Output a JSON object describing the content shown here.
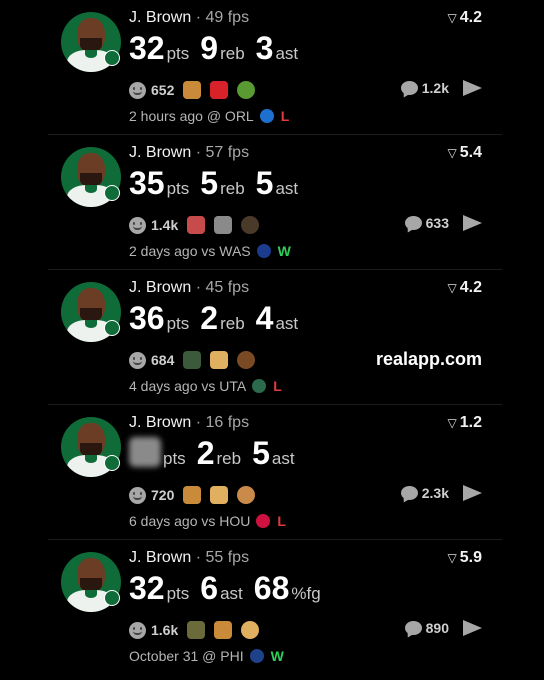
{
  "posts": [
    {
      "player": "J. Brown",
      "fps": "· 49 fps",
      "score": "4.2",
      "stats": [
        {
          "value": "32",
          "unit": "pts"
        },
        {
          "value": "9",
          "unit": "reb"
        },
        {
          "value": "3",
          "unit": "ast"
        }
      ],
      "stat1_blurred": false,
      "reaction_count": "652",
      "emojis": [
        "person-tipping-hand-emoji",
        "turkey-flag-emoji",
        "nauseated-face-emoji"
      ],
      "emoji_colors": [
        "#c98a3a",
        "#d8222a",
        "#5a9a32"
      ],
      "comment_count": "1.2k",
      "show_watermark": false,
      "game_text": "2 hours ago @ ORL",
      "opponent_logo": "orl-logo-icon",
      "opponent_color": "#1f6fcf",
      "result": "L"
    },
    {
      "player": "J. Brown",
      "fps": "· 57 fps",
      "score": "5.4",
      "stats": [
        {
          "value": "35",
          "unit": "pts"
        },
        {
          "value": "5",
          "unit": "reb"
        },
        {
          "value": "5",
          "unit": "ast"
        }
      ],
      "stat1_blurred": false,
      "reaction_count": "1.4k",
      "emojis": [
        "barber-pole-emoji",
        "goat-emoji",
        "guitar-player-emoji"
      ],
      "emoji_colors": [
        "#c84b4b",
        "#8a8a8a",
        "#4a3a2a"
      ],
      "comment_count": "633",
      "show_watermark": false,
      "game_text": "2 days ago vs WAS",
      "opponent_logo": "was-logo-icon",
      "opponent_color": "#1b3c8c",
      "result": "W"
    },
    {
      "player": "J. Brown",
      "fps": "· 45 fps",
      "score": "4.2",
      "stats": [
        {
          "value": "36",
          "unit": "pts"
        },
        {
          "value": "2",
          "unit": "reb"
        },
        {
          "value": "4",
          "unit": "ast"
        }
      ],
      "stat1_blurred": false,
      "reaction_count": "684",
      "emojis": [
        "person-emoji",
        "baby-emoji",
        "pile-of-poo-emoji"
      ],
      "emoji_colors": [
        "#3b5a3b",
        "#e0b060",
        "#7a4a24"
      ],
      "comment_count": "",
      "show_watermark": true,
      "watermark": "realapp.com",
      "game_text": "4 days ago vs UTA",
      "opponent_logo": "uta-logo-icon",
      "opponent_color": "#2b6a4a",
      "result": "L"
    },
    {
      "player": "J. Brown",
      "fps": "· 16 fps",
      "score": "1.2",
      "stats": [
        {
          "value": "",
          "unit": "pts"
        },
        {
          "value": "2",
          "unit": "reb"
        },
        {
          "value": "5",
          "unit": "ast"
        }
      ],
      "stat1_blurred": true,
      "reaction_count": "720",
      "emojis": [
        "person-tipping-hand-emoji",
        "baby-emoji",
        "cookie-emoji"
      ],
      "emoji_colors": [
        "#c98a3a",
        "#e0b060",
        "#c98a4a"
      ],
      "comment_count": "2.3k",
      "show_watermark": false,
      "game_text": "6 days ago vs HOU",
      "opponent_logo": "hou-logo-icon",
      "opponent_color": "#ce1141",
      "result": "L"
    },
    {
      "player": "J. Brown",
      "fps": "· 55 fps",
      "score": "5.9",
      "stats": [
        {
          "value": "32",
          "unit": "pts"
        },
        {
          "value": "6",
          "unit": "ast"
        },
        {
          "value": "68",
          "unit": "%fg"
        }
      ],
      "stat1_blurred": false,
      "reaction_count": "1.6k",
      "emojis": [
        "hand-gesture-emoji",
        "person-tipping-hand-emoji",
        "baby-emoji"
      ],
      "emoji_colors": [
        "#6a6a3a",
        "#c98a3a",
        "#e0b060"
      ],
      "comment_count": "890",
      "show_watermark": false,
      "game_text": "October 31 @ PHI",
      "opponent_logo": "phi-logo-icon",
      "opponent_color": "#1d428a",
      "result": "W"
    }
  ]
}
